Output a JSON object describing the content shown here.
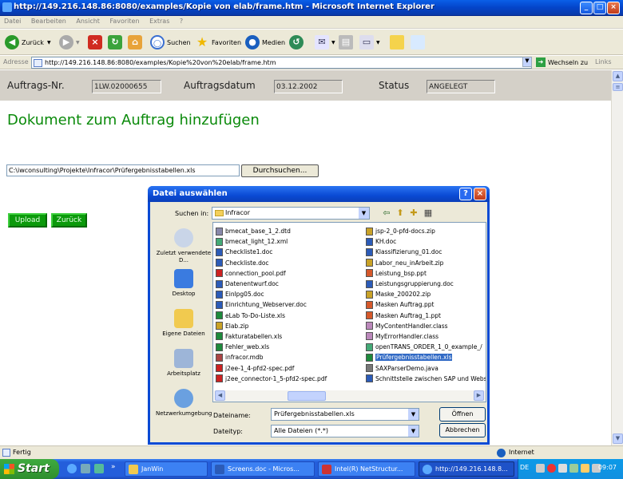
{
  "window": {
    "title": "http://149.216.148.86:8080/examples/Kopie von elab/frame.htm - Microsoft Internet Explorer"
  },
  "menu": [
    "Datei",
    "Bearbeiten",
    "Ansicht",
    "Favoriten",
    "Extras",
    "?"
  ],
  "toolbar": {
    "back": "Zurück",
    "search": "Suchen",
    "favorites": "Favoriten",
    "media": "Medien"
  },
  "address": {
    "label": "Adresse",
    "url": "http://149.216.148.86:8080/examples/Kopie%20von%20elab/frame.htm",
    "go": "Wechseln zu",
    "links": "Links"
  },
  "page": {
    "order_no_label": "Auftrags-Nr.",
    "order_no": "1LW.02000655",
    "order_date_label": "Auftragsdatum",
    "order_date": "03.12.2002",
    "status_label": "Status",
    "status": "ANGELEGT",
    "heading": "Dokument zum Auftrag hinzufügen",
    "file_path": "C:\\iwconsulting\\Projekte\\Infracor\\Prüfergebnisstabellen.xls",
    "browse": "Durchsuchen...",
    "upload": "Upload",
    "back": "Zurück"
  },
  "dialog": {
    "title": "Datei auswählen",
    "look_in_label": "Suchen in:",
    "look_in": "Infracor",
    "places": [
      "Zuletzt verwendete D...",
      "Desktop",
      "Eigene Dateien",
      "Arbeitsplatz",
      "Netzwerkumgebung"
    ],
    "files_col1": [
      {
        "name": "bmecat_base_1_2.dtd",
        "type": "dtd"
      },
      {
        "name": "bmecat_light_12.xml",
        "type": "xml"
      },
      {
        "name": "Checkliste1.doc",
        "type": "doc"
      },
      {
        "name": "Checkliste.doc",
        "type": "doc"
      },
      {
        "name": "connection_pool.pdf",
        "type": "pdf"
      },
      {
        "name": "Datenentwurf.doc",
        "type": "doc"
      },
      {
        "name": "Einlpg05.doc",
        "type": "doc"
      },
      {
        "name": "Einrichtung_Webserver.doc",
        "type": "doc"
      },
      {
        "name": "eLab To-Do-Liste.xls",
        "type": "xls"
      },
      {
        "name": "Elab.zip",
        "type": "zip"
      },
      {
        "name": "Fakturatabellen.xls",
        "type": "xls"
      },
      {
        "name": "Fehler_web.xls",
        "type": "xls"
      },
      {
        "name": "infracor.mdb",
        "type": "mdb"
      },
      {
        "name": "j2ee-1_4-pfd2-spec.pdf",
        "type": "pdf"
      },
      {
        "name": "j2ee_connector-1_5-pfd2-spec.pdf",
        "type": "pdf"
      }
    ],
    "files_col2": [
      {
        "name": "jsp-2_0-pfd-docs.zip",
        "type": "zip"
      },
      {
        "name": "KH.doc",
        "type": "doc"
      },
      {
        "name": "Klassifizierung_01.doc",
        "type": "doc"
      },
      {
        "name": "Labor_neu_inArbeit.zip",
        "type": "zip"
      },
      {
        "name": "Leistung_bsp.ppt",
        "type": "ppt"
      },
      {
        "name": "Leistungsgruppierung.doc",
        "type": "doc"
      },
      {
        "name": "Maske_200202.zip",
        "type": "zip"
      },
      {
        "name": "Masken Auftrag.ppt",
        "type": "ppt"
      },
      {
        "name": "Masken Auftrag_1.ppt",
        "type": "ppt"
      },
      {
        "name": "MyContentHandler.class",
        "type": "class"
      },
      {
        "name": "MyErrorHandler.class",
        "type": "class"
      },
      {
        "name": "openTRANS_ORDER_1_0_example_/",
        "type": "xml"
      },
      {
        "name": "Prüfergebnisstabellen.xls",
        "type": "xls",
        "selected": true
      },
      {
        "name": "SAXParserDemo.java",
        "type": "java"
      },
      {
        "name": "Schnittstelle zwischen SAP und Webs",
        "type": "doc"
      }
    ],
    "filename_label": "Dateiname:",
    "filename": "Prüfergebnisstabellen.xls",
    "filetype_label": "Dateityp:",
    "filetype": "Alle Dateien (*.*)",
    "open": "Öffnen",
    "cancel": "Abbrechen"
  },
  "status": {
    "left": "Fertig",
    "right": "Internet"
  },
  "taskbar": {
    "start": "Start",
    "tasks": [
      "JanWin",
      "Screens.doc - Micros...",
      "Intel(R) NetStructur...",
      "http://149.216.148.8..."
    ],
    "lang": "DE",
    "clock": "09:07"
  }
}
